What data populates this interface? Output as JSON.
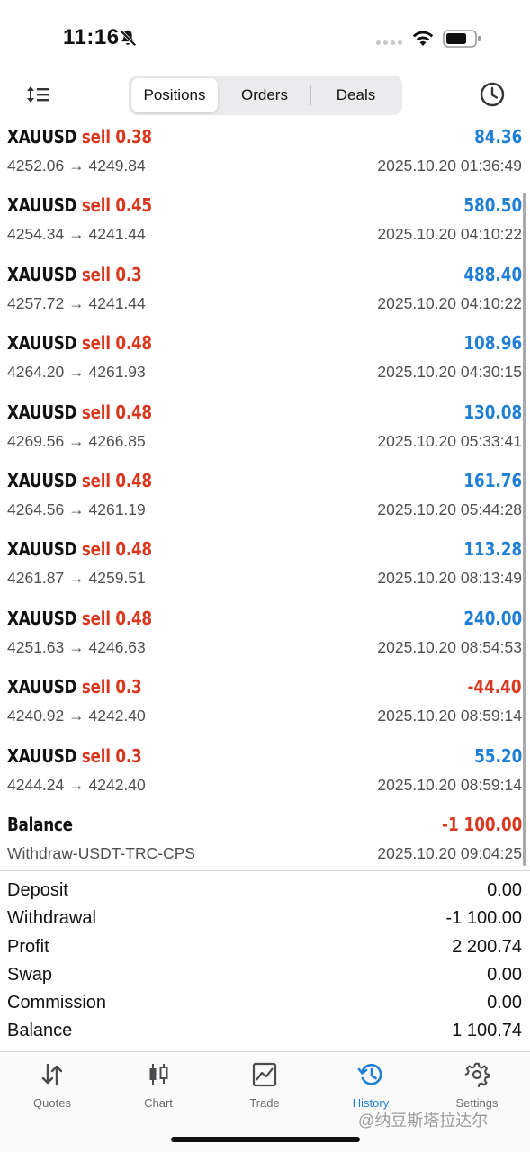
{
  "status_bar": {
    "time": "11:16"
  },
  "tabs": [
    {
      "label": "Positions",
      "active": true
    },
    {
      "label": "Orders",
      "active": false
    },
    {
      "label": "Deals",
      "active": false
    }
  ],
  "deals": [
    {
      "symbol": "XAUUSD",
      "side": "sell",
      "volume": "0.38",
      "open": "4252.06",
      "close": "4249.84",
      "profit": "84.36",
      "time": "2025.10.20 01:36:49",
      "profit_color": "#1f7fd6"
    },
    {
      "symbol": "XAUUSD",
      "side": "sell",
      "volume": "0.45",
      "open": "4254.34",
      "close": "4241.44",
      "profit": "580.50",
      "time": "2025.10.20 04:10:22",
      "profit_color": "#1f7fd6"
    },
    {
      "symbol": "XAUUSD",
      "side": "sell",
      "volume": "0.3",
      "open": "4257.72",
      "close": "4241.44",
      "profit": "488.40",
      "time": "2025.10.20 04:10:22",
      "profit_color": "#1f7fd6"
    },
    {
      "symbol": "XAUUSD",
      "side": "sell",
      "volume": "0.48",
      "open": "4264.20",
      "close": "4261.93",
      "profit": "108.96",
      "time": "2025.10.20 04:30:15",
      "profit_color": "#1f7fd6"
    },
    {
      "symbol": "XAUUSD",
      "side": "sell",
      "volume": "0.48",
      "open": "4269.56",
      "close": "4266.85",
      "profit": "130.08",
      "time": "2025.10.20 05:33:41",
      "profit_color": "#1f7fd6"
    },
    {
      "symbol": "XAUUSD",
      "side": "sell",
      "volume": "0.48",
      "open": "4264.56",
      "close": "4261.19",
      "profit": "161.76",
      "time": "2025.10.20 05:44:28",
      "profit_color": "#1f7fd6"
    },
    {
      "symbol": "XAUUSD",
      "side": "sell",
      "volume": "0.48",
      "open": "4261.87",
      "close": "4259.51",
      "profit": "113.28",
      "time": "2025.10.20 08:13:49",
      "profit_color": "#1f7fd6"
    },
    {
      "symbol": "XAUUSD",
      "side": "sell",
      "volume": "0.48",
      "open": "4251.63",
      "close": "4246.63",
      "profit": "240.00",
      "time": "2025.10.20 08:54:53",
      "profit_color": "#1f7fd6"
    },
    {
      "symbol": "XAUUSD",
      "side": "sell",
      "volume": "0.3",
      "open": "4240.92",
      "close": "4242.40",
      "profit": "-44.40",
      "time": "2025.10.20 08:59:14",
      "profit_color": "#d9381e"
    },
    {
      "symbol": "XAUUSD",
      "side": "sell",
      "volume": "0.3",
      "open": "4244.24",
      "close": "4242.40",
      "profit": "55.20",
      "time": "2025.10.20 08:59:14",
      "profit_color": "#1f7fd6"
    }
  ],
  "balance_op": {
    "title": "Balance",
    "comment": "Withdraw-USDT-TRC-CPS",
    "amount": "-1 100.00",
    "time": "2025.10.20 09:04:25",
    "amount_color": "#d9381e"
  },
  "summary": [
    {
      "label": "Deposit",
      "value": "0.00"
    },
    {
      "label": "Withdrawal",
      "value": "-1 100.00"
    },
    {
      "label": "Profit",
      "value": "2 200.74"
    },
    {
      "label": "Swap",
      "value": "0.00"
    },
    {
      "label": "Commission",
      "value": "0.00"
    },
    {
      "label": "Balance",
      "value": "1 100.74"
    }
  ],
  "bottom_nav": [
    {
      "label": "Quotes",
      "icon": "quotes-arrows-icon",
      "active": false
    },
    {
      "label": "Chart",
      "icon": "candlestick-chart-icon",
      "active": false
    },
    {
      "label": "Trade",
      "icon": "trade-chart-icon",
      "active": false
    },
    {
      "label": "History",
      "icon": "history-clock-icon",
      "active": true
    },
    {
      "label": "Settings",
      "icon": "gear-icon",
      "active": false
    }
  ],
  "watermark": "@纳豆斯塔拉达尔",
  "colors": {
    "accent": "#1f7fd6",
    "sell": "#d9381e",
    "negative": "#d9381e"
  }
}
